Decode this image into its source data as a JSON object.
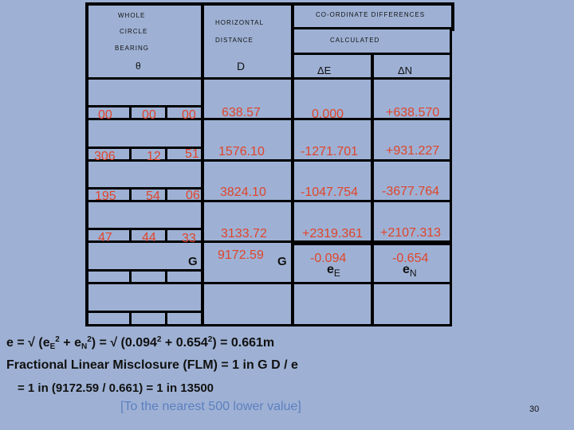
{
  "table": {
    "header": {
      "bearing_lines": [
        "WHOLE",
        "CIRCLE",
        "BEARING"
      ],
      "bearing_symbol": "θ",
      "distance_lines": [
        "HORIZONTAL",
        "DISTANCE"
      ],
      "distance_symbol": "D",
      "coord_title": "CO-ORDINATE DIFFERENCES",
      "calculated": "CALCULATED",
      "dE": "ΔE",
      "dN": "ΔN"
    },
    "rows": [
      {
        "deg": "00",
        "min": "00",
        "sec": "00",
        "distance": "638.57",
        "dE": "0.000",
        "dN": "+638.570"
      },
      {
        "deg": "306",
        "min": "12",
        "sec": "51",
        "distance": "1576.10",
        "dE": "-1271.701",
        "dN": "+931.227"
      },
      {
        "deg": "195",
        "min": "54",
        "sec": "06",
        "distance": "3824.10",
        "dE": "-1047.754",
        "dN": "-3677.764"
      },
      {
        "deg": "47",
        "min": "44",
        "sec": "33",
        "distance": "3133.72",
        "dE": "+2319.361",
        "dN": "+2107.313"
      }
    ],
    "totals": {
      "bearing_sum_label": "G",
      "distance_total": "9172.59",
      "distance_sum_label": "G",
      "eE_value": "-0.094",
      "eE_label": "e",
      "eE_sub": "E",
      "eN_value": "-0.654",
      "eN_label": "e",
      "eN_sub": "N"
    }
  },
  "formula": {
    "line1": {
      "p1": "e = √ (e",
      "s1": "E",
      "sup1": "2",
      "p2": " + e",
      "s2": "N",
      "sup2": "2",
      "p3": ")  = √ (0.094",
      "sup3": "2",
      "p4": " + 0.654",
      "sup4": "2",
      "p5": ")  = 0.661m"
    },
    "line2": "Fractional Linear Misclosure (FLM)  =  1 in G D / e",
    "line3": "= 1 in (9172.59 / 0.661) = 1 in 13500",
    "note": "[To the nearest 500 lower value]"
  },
  "page_number": "30",
  "colors": {
    "background": "#9eb1d4",
    "values": "#e0452b",
    "note": "#5d7fbf"
  }
}
